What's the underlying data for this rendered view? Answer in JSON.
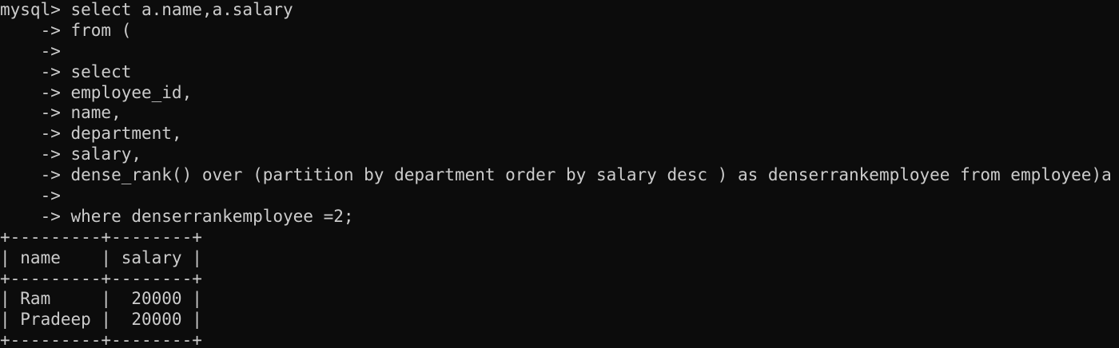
{
  "terminal": {
    "lines": [
      "mysql> select a.name,a.salary",
      "    -> from (",
      "    ->",
      "    -> select",
      "    -> employee_id,",
      "    -> name,",
      "    -> department,",
      "    -> salary,",
      "    -> dense_rank() over (partition by department order by salary desc ) as denserrankemployee from employee)a",
      "    ->",
      "    -> where denserrankemployee =2;",
      "+---------+--------+",
      "| name    | salary |",
      "+---------+--------+",
      "| Ram     |  20000 |",
      "| Pradeep |  20000 |",
      "+---------+--------+"
    ]
  },
  "colors": {
    "background": "#0c0c0c",
    "text": "#cccccc"
  }
}
